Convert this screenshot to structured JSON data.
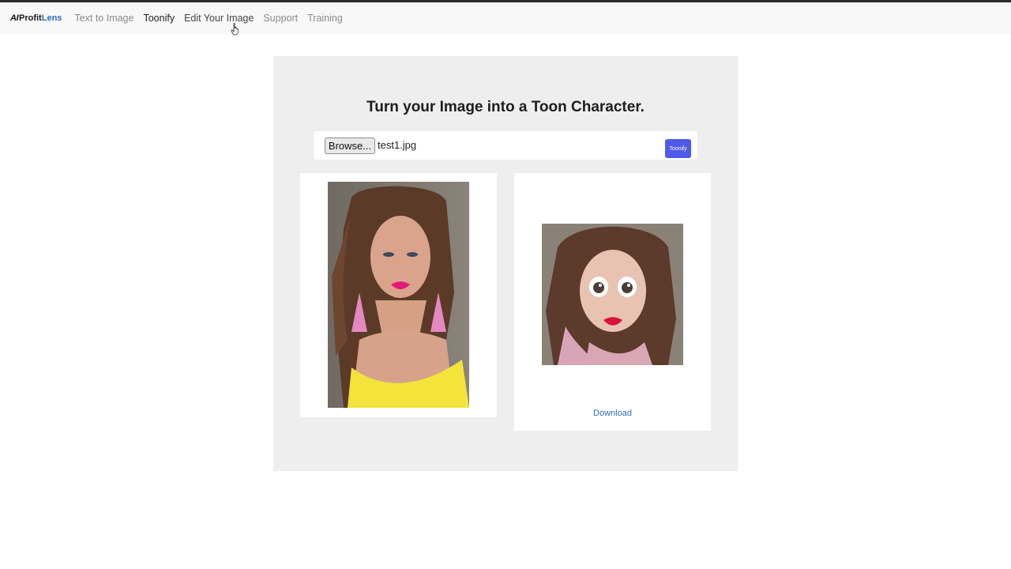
{
  "brand": {
    "prefix": "AI",
    "name_main": "Profit",
    "name_accent": "Lens"
  },
  "nav": [
    {
      "label": "Text to Image"
    },
    {
      "label": "Toonify"
    },
    {
      "label": "Edit Your Image"
    },
    {
      "label": "Support"
    },
    {
      "label": "Training"
    }
  ],
  "main": {
    "title": "Turn your Image into a Toon Character.",
    "upload": {
      "browse_label": "Browse...",
      "filename": "test1.jpg",
      "submit_label": "Toonify"
    },
    "result": {
      "download_label": "Download"
    }
  },
  "colors": {
    "accent": "#4f5be8",
    "link": "#2d6bc4",
    "panel_bg": "#eeeeee"
  }
}
